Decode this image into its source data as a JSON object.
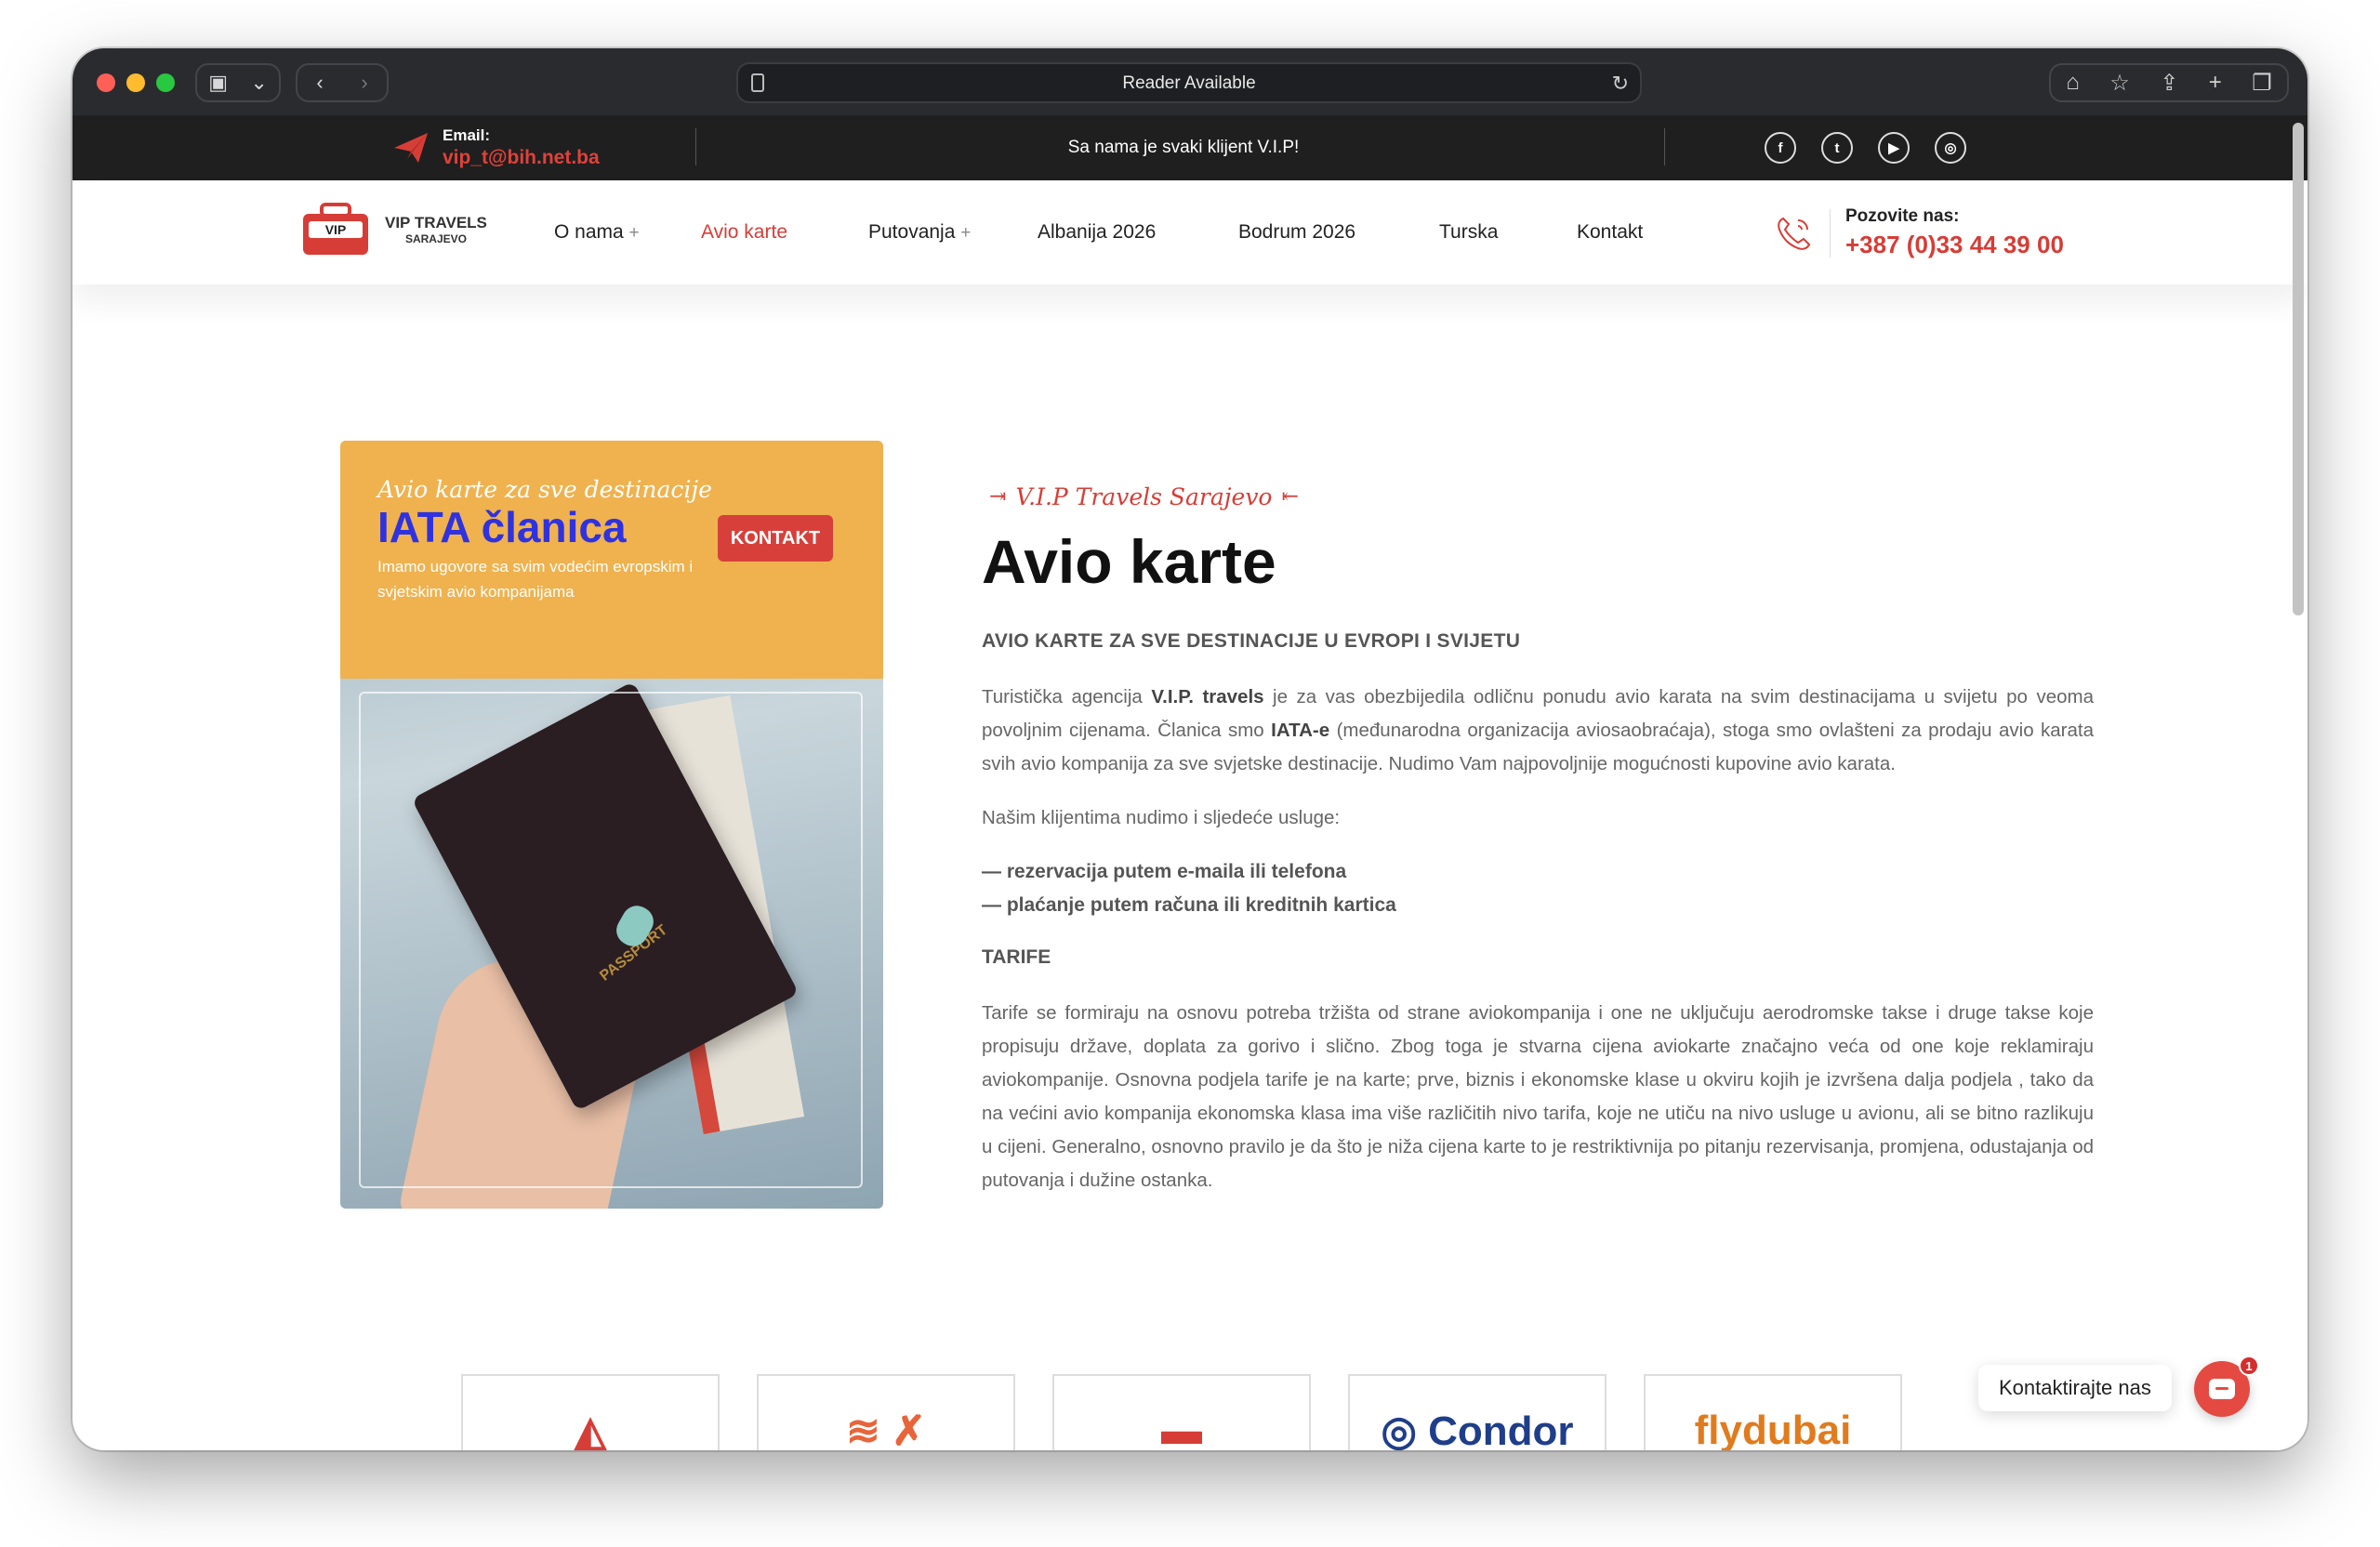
{
  "browser": {
    "address_text": "Reader Available"
  },
  "topbar": {
    "email_label": "Email:",
    "email_value": "vip_t@bih.net.ba",
    "tagline": "Sa nama je svaki klijent V.I.P!",
    "socials": [
      "f",
      "t",
      "yt",
      "ig"
    ]
  },
  "nav": {
    "logo_name": "VIP TRAVELS",
    "logo_city": "SARAJEVO",
    "items": [
      {
        "label": "O nama",
        "plus": "+"
      },
      {
        "label": "Avio karte"
      },
      {
        "label": "Putovanja",
        "plus": "+"
      },
      {
        "label": "Albanija 2026"
      },
      {
        "label": "Bodrum 2026"
      },
      {
        "label": "Turska"
      },
      {
        "label": "Kontakt"
      }
    ],
    "phone_label": "Pozovite nas:",
    "phone_number": "+387 (0)33 44 39 00",
    "active_color": "#d63d36"
  },
  "promo": {
    "script": "Avio karte za sve destinacije",
    "title": "IATA članica",
    "subtitle": "Imamo ugovore sa svim vodećim evropskim i svjetskim avio kompanijama",
    "button": "KONTAKT",
    "passport_label": "PASSPORT"
  },
  "content": {
    "kicker": "V.I.P Travels Sarajevo",
    "title": "Avio karte",
    "lead": "AVIO KARTE ZA SVE DESTINACIJE U EVROPI I SVIJETU",
    "p1_a": "Turistička agencija ",
    "p1_b": "V.I.P. travels",
    "p1_c": " je za vas obezbijedila odličnu ponudu avio karata na svim destinacijama u svijetu po veoma povoljnim cijenama. Članica smo ",
    "p1_d": "IATA-e",
    "p1_e": " (međunarodna organizacija aviosaobraćaja), stoga smo ovlašteni za prodaju avio karata svih avio kompanija za sve svjetske destinacije. Nudimo Vam najpovoljnije mogućnosti kupovine avio karata.",
    "p2": "Našim klijentima nudimo i sljedeće usluge:",
    "bullet1": "— rezervacija putem e-maila ili telefona",
    "bullet2": "— plaćanje putem računa ili kreditnih kartica",
    "tarife": "TARIFE",
    "p3": "Tarife se formiraju na osnovu potreba tržišta od strane aviokompanija i one ne uključuju aerodromske takse i druge takse koje propisuju države, doplata za gorivo i slično. Zbog toga je stvarna cijena aviokarte značajno veća od one koje reklamiraju aviokompanije. Osnovna podjela tarife je na karte; prve, biznis i ekonomske klase u okviru kojih je izvršena dalja podjela , tako da na većini avio kompanija ekonomska klasa ima više različitih nivo tarifa, koje ne utiču na nivo usluge u avionu, ali se bitno razlikuju u cijeni. Generalno, osnovno pravilo je da što je niža cijena karte to je restriktivnija po pitanju rezervisanja, promjena, odustajanja od putovanja i dužine ostanka."
  },
  "airlines": [
    {
      "name": "airline-1",
      "mark": "◭"
    },
    {
      "name": "airline-2",
      "mark": "≋ ✗"
    },
    {
      "name": "airline-3",
      "mark": "▬"
    },
    {
      "name": "condor",
      "mark": "◎ Condor"
    },
    {
      "name": "flydubai",
      "mark": "flydubai"
    }
  ],
  "chat": {
    "label": "Kontaktirajte nas",
    "badge": "1"
  }
}
